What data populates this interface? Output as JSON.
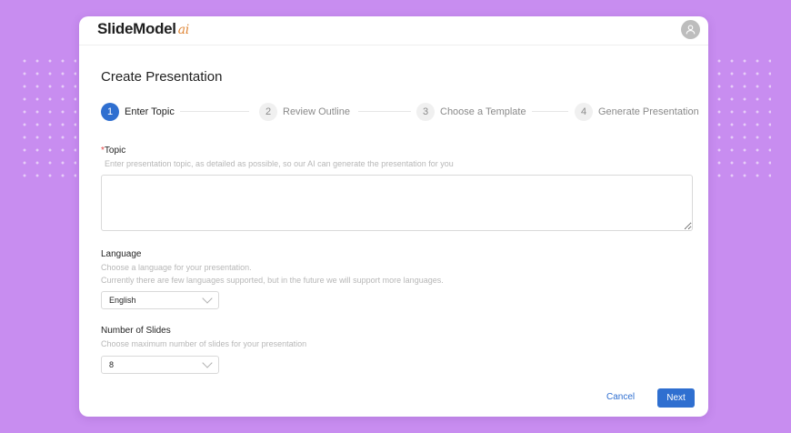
{
  "header": {
    "brand": "SlideModel",
    "brand_suffix": "ai",
    "avatar_icon": "user-icon"
  },
  "page": {
    "title": "Create Presentation"
  },
  "steps": [
    {
      "num": "1",
      "label": "Enter Topic",
      "active": true
    },
    {
      "num": "2",
      "label": "Review Outline",
      "active": false
    },
    {
      "num": "3",
      "label": "Choose a Template",
      "active": false
    },
    {
      "num": "4",
      "label": "Generate Presentation",
      "active": false
    }
  ],
  "topic": {
    "required_mark": "*",
    "label": "Topic",
    "hint": "Enter presentation topic, as detailed as possible, so our AI can generate the presentation for you",
    "value": ""
  },
  "language": {
    "label": "Language",
    "hint_1": "Choose a language for your presentation.",
    "hint_2": "Currently there are few languages supported, but in the future we will support more languages.",
    "selected": "English"
  },
  "slides": {
    "label": "Number of Slides",
    "hint": "Choose maximum number of slides for your presentation",
    "selected": "8"
  },
  "actions": {
    "cancel": "Cancel",
    "next": "Next"
  },
  "colors": {
    "background": "#c88df0",
    "primary": "#2f6fd0",
    "required": "#e04646",
    "brand_suffix": "#e0883a"
  }
}
